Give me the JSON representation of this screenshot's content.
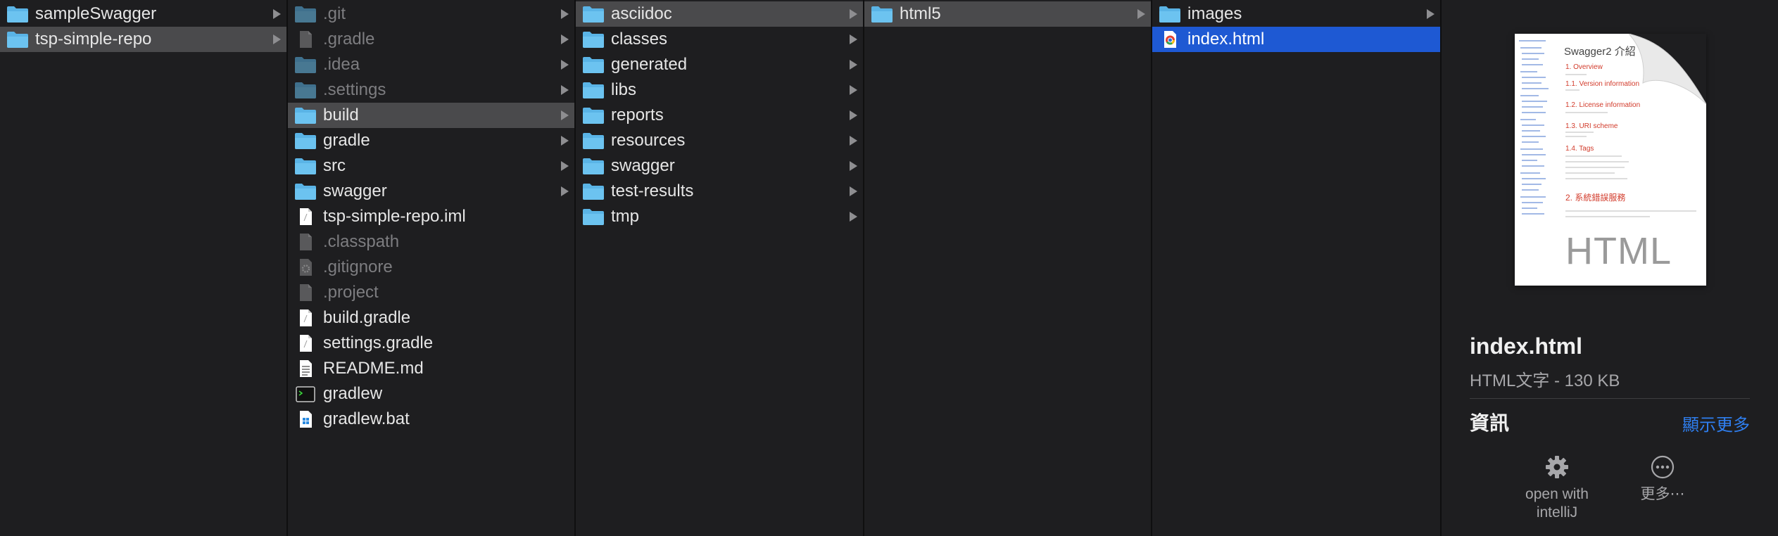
{
  "colors": {
    "background": "#1e1e20",
    "selection_gray": "#4a4a4c",
    "selection_blue": "#1e59d3",
    "folder_blue": "#5ab4e6",
    "link_blue": "#2f7ff0"
  },
  "columns": [
    {
      "items": [
        {
          "name": "sampleSwagger",
          "icon": "folder-icon",
          "has_children": true,
          "dim": false,
          "selected": null
        },
        {
          "name": "tsp-simple-repo",
          "icon": "folder-icon",
          "has_children": true,
          "dim": false,
          "selected": "gray"
        }
      ]
    },
    {
      "items": [
        {
          "name": ".git",
          "icon": "folder-icon",
          "has_children": true,
          "dim": true,
          "selected": null
        },
        {
          "name": ".gradle",
          "icon": "file-icon",
          "has_children": true,
          "dim": true,
          "selected": null
        },
        {
          "name": ".idea",
          "icon": "folder-icon",
          "has_children": true,
          "dim": true,
          "selected": null
        },
        {
          "name": ".settings",
          "icon": "folder-icon",
          "has_children": true,
          "dim": true,
          "selected": null
        },
        {
          "name": "build",
          "icon": "folder-icon",
          "has_children": true,
          "dim": false,
          "selected": "gray"
        },
        {
          "name": "gradle",
          "icon": "folder-icon",
          "has_children": true,
          "dim": false,
          "selected": null
        },
        {
          "name": "src",
          "icon": "folder-icon",
          "has_children": true,
          "dim": false,
          "selected": null
        },
        {
          "name": "swagger",
          "icon": "folder-icon",
          "has_children": true,
          "dim": false,
          "selected": null
        },
        {
          "name": "tsp-simple-repo.iml",
          "icon": "document-icon",
          "has_children": false,
          "dim": false,
          "selected": null
        },
        {
          "name": ".classpath",
          "icon": "file-icon",
          "has_children": false,
          "dim": true,
          "selected": null
        },
        {
          "name": ".gitignore",
          "icon": "gear-file-icon",
          "has_children": false,
          "dim": true,
          "selected": null
        },
        {
          "name": ".project",
          "icon": "file-icon",
          "has_children": false,
          "dim": true,
          "selected": null
        },
        {
          "name": "build.gradle",
          "icon": "document-icon",
          "has_children": false,
          "dim": false,
          "selected": null
        },
        {
          "name": "settings.gradle",
          "icon": "document-icon",
          "has_children": false,
          "dim": false,
          "selected": null
        },
        {
          "name": "README.md",
          "icon": "text-document-icon",
          "has_children": false,
          "dim": false,
          "selected": null
        },
        {
          "name": "gradlew",
          "icon": "terminal-icon",
          "has_children": false,
          "dim": false,
          "selected": null
        },
        {
          "name": "gradlew.bat",
          "icon": "windows-file-icon",
          "has_children": false,
          "dim": false,
          "selected": null
        }
      ]
    },
    {
      "items": [
        {
          "name": "asciidoc",
          "icon": "folder-icon",
          "has_children": true,
          "dim": false,
          "selected": "gray"
        },
        {
          "name": "classes",
          "icon": "folder-icon",
          "has_children": true,
          "dim": false,
          "selected": null
        },
        {
          "name": "generated",
          "icon": "folder-icon",
          "has_children": true,
          "dim": false,
          "selected": null
        },
        {
          "name": "libs",
          "icon": "folder-icon",
          "has_children": true,
          "dim": false,
          "selected": null
        },
        {
          "name": "reports",
          "icon": "folder-icon",
          "has_children": true,
          "dim": false,
          "selected": null
        },
        {
          "name": "resources",
          "icon": "folder-icon",
          "has_children": true,
          "dim": false,
          "selected": null
        },
        {
          "name": "swagger",
          "icon": "folder-icon",
          "has_children": true,
          "dim": false,
          "selected": null
        },
        {
          "name": "test-results",
          "icon": "folder-icon",
          "has_children": true,
          "dim": false,
          "selected": null
        },
        {
          "name": "tmp",
          "icon": "folder-icon",
          "has_children": true,
          "dim": false,
          "selected": null
        }
      ]
    },
    {
      "items": [
        {
          "name": "html5",
          "icon": "folder-icon",
          "has_children": true,
          "dim": false,
          "selected": "gray"
        }
      ]
    },
    {
      "items": [
        {
          "name": "images",
          "icon": "folder-icon",
          "has_children": true,
          "dim": false,
          "selected": null
        },
        {
          "name": "index.html",
          "icon": "chrome-html-icon",
          "has_children": false,
          "dim": false,
          "selected": "blue"
        }
      ]
    }
  ],
  "preview": {
    "thumbnail_title": "Swagger2 介紹",
    "thumbnail_big_text": "HTML",
    "file_name": "index.html",
    "file_kind": "HTML文字 - 130 KB",
    "info_heading": "資訊",
    "show_more": "顯示更多",
    "actions": [
      {
        "icon": "gear-icon",
        "label": "open with\nintelliJ"
      },
      {
        "icon": "ellipsis-icon",
        "label": "更多⋯"
      }
    ]
  }
}
